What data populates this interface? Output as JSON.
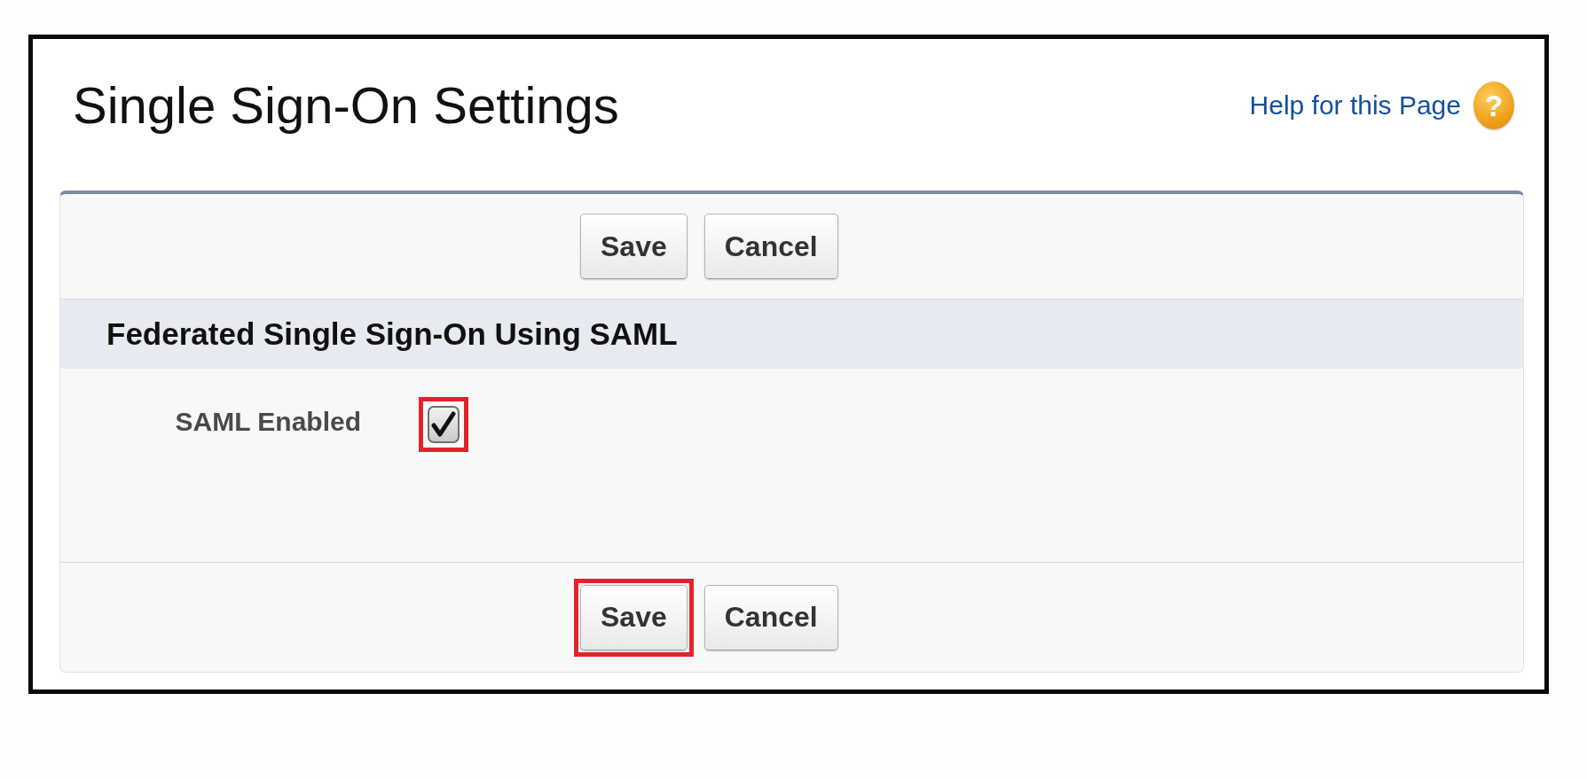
{
  "header": {
    "title": "Single Sign-On Settings",
    "help_link": "Help for this Page",
    "help_icon": "?"
  },
  "top_buttons": [
    {
      "label": "Save",
      "highlighted": false
    },
    {
      "label": "Cancel",
      "highlighted": false
    }
  ],
  "section": {
    "title": "Federated Single Sign-On Using SAML",
    "fields": [
      {
        "kind": "checkbox",
        "label": "SAML Enabled",
        "checked": true,
        "highlighted": true
      }
    ]
  },
  "bottom_buttons": [
    {
      "label": "Save",
      "highlighted": true
    },
    {
      "label": "Cancel",
      "highlighted": false
    }
  ]
}
